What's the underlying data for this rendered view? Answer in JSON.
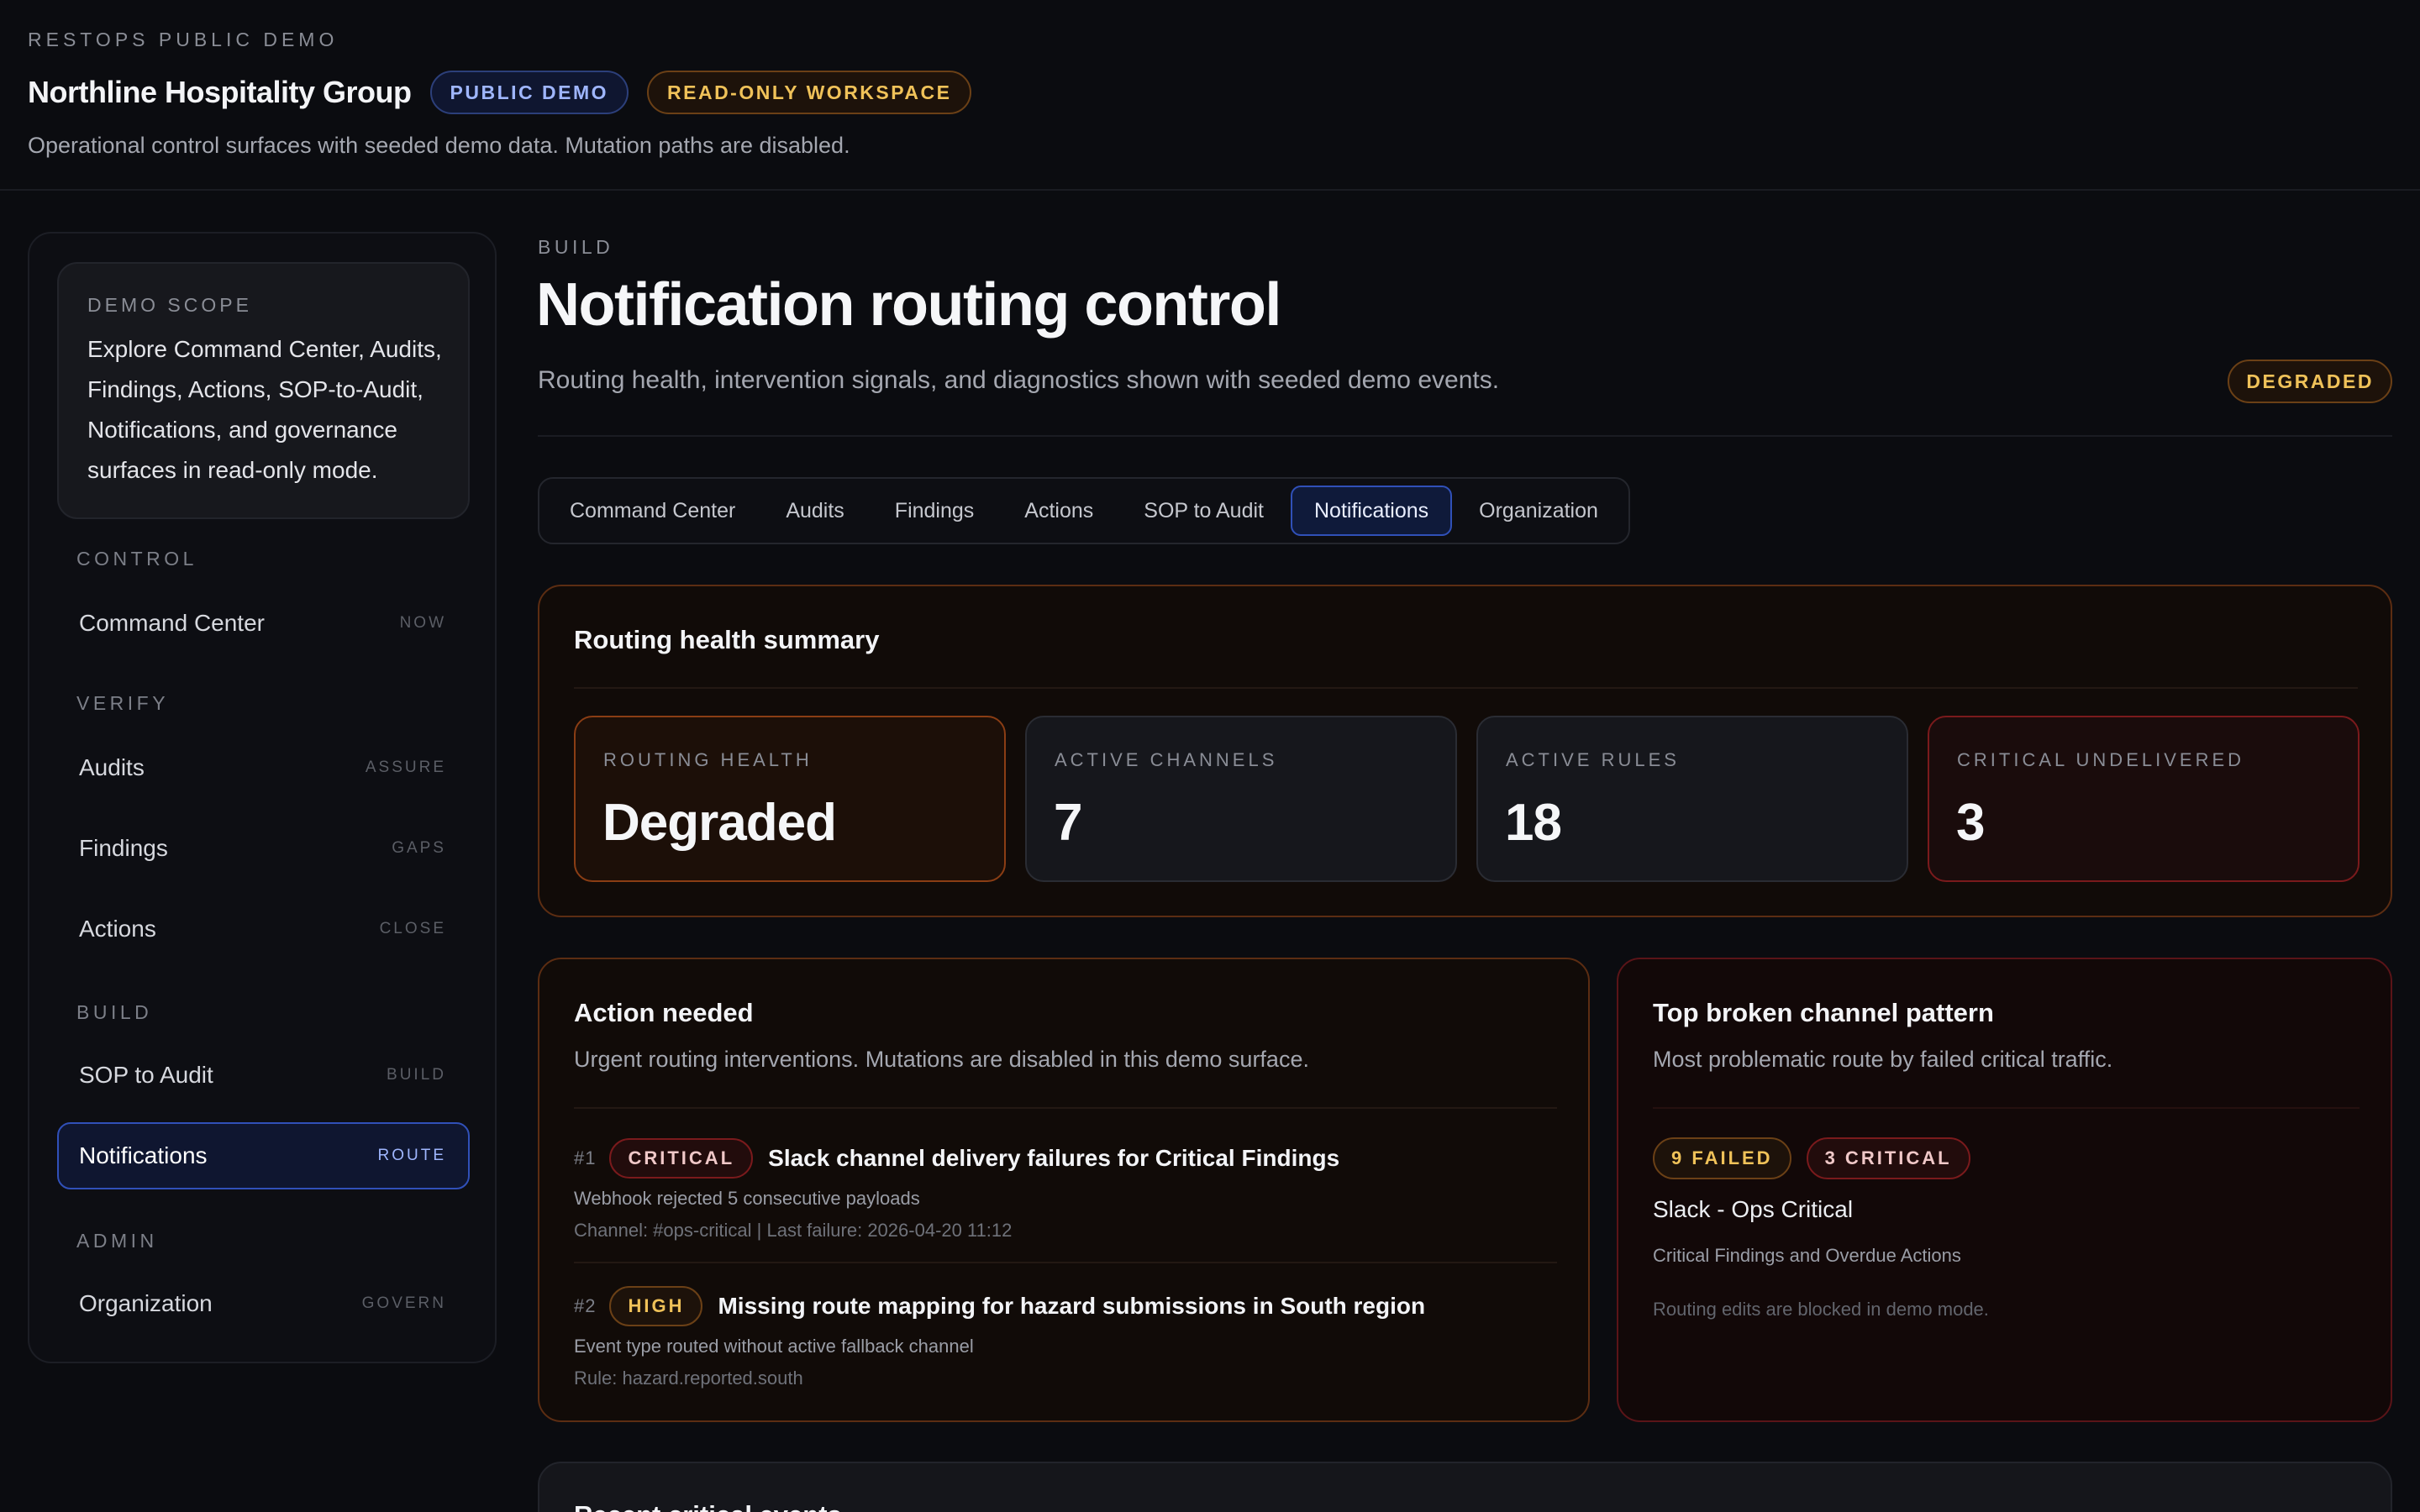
{
  "header": {
    "eyebrow": "RESTOPS PUBLIC DEMO",
    "org_name": "Northline Hospitality Group",
    "badges": [
      "PUBLIC DEMO",
      "READ-ONLY WORKSPACE"
    ],
    "subtitle": "Operational control surfaces with seeded demo data. Mutation paths are disabled."
  },
  "sidebar": {
    "scope": {
      "title": "DEMO SCOPE",
      "text": "Explore Command Center, Audits, Findings, Actions, SOP-to-Audit, Notifications, and governance surfaces in read-only mode."
    },
    "sections": [
      "CONTROL",
      "VERIFY",
      "BUILD",
      "ADMIN"
    ],
    "items": [
      {
        "label": "Command Center",
        "tag": "NOW"
      },
      {
        "label": "Audits",
        "tag": "ASSURE"
      },
      {
        "label": "Findings",
        "tag": "GAPS"
      },
      {
        "label": "Actions",
        "tag": "CLOSE"
      },
      {
        "label": "SOP to Audit",
        "tag": "BUILD"
      },
      {
        "label": "Notifications",
        "tag": "ROUTE",
        "active": true
      },
      {
        "label": "Organization",
        "tag": "GOVERN"
      }
    ]
  },
  "page": {
    "eyebrow": "BUILD",
    "title": "Notification routing control",
    "subtitle": "Routing health, intervention signals, and diagnostics shown with seeded demo events.",
    "status": "DEGRADED"
  },
  "tabs": [
    "Command Center",
    "Audits",
    "Findings",
    "Actions",
    "SOP to Audit",
    "Notifications",
    "Organization"
  ],
  "active_tab": "Notifications",
  "summary": {
    "title": "Routing health summary",
    "metrics": [
      {
        "label": "ROUTING HEALTH",
        "value": "Degraded"
      },
      {
        "label": "ACTIVE CHANNELS",
        "value": "7"
      },
      {
        "label": "ACTIVE RULES",
        "value": "18"
      },
      {
        "label": "CRITICAL UNDELIVERED",
        "value": "3"
      }
    ]
  },
  "action_needed": {
    "title": "Action needed",
    "subtitle": "Urgent routing interventions. Mutations are disabled in this demo surface.",
    "issues": [
      {
        "rank": "#1",
        "severity": "CRITICAL",
        "title": "Slack channel delivery failures for Critical Findings",
        "detail": "Webhook rejected 5 consecutive payloads",
        "meta": "Channel: #ops-critical | Last failure: 2026-04-20 11:12"
      },
      {
        "rank": "#2",
        "severity": "HIGH",
        "title": "Missing route mapping for hazard submissions in South region",
        "detail": "Event type routed without active fallback channel",
        "meta": "Rule: hazard.reported.south"
      }
    ]
  },
  "broken_channel": {
    "title": "Top broken channel pattern",
    "subtitle": "Most problematic route by failed critical traffic.",
    "badges": [
      "9 FAILED",
      "3 CRITICAL"
    ],
    "channel": "Slack - Ops Critical",
    "description": "Critical Findings and Overdue Actions",
    "note": "Routing edits are blocked in demo mode."
  },
  "bottom_card": {
    "title": "Recent critical events"
  },
  "colors": {
    "background": "#0b0c10",
    "accent_blue": "#3050b8",
    "amber": "#f0c259",
    "critical_red": "#7a1a1c"
  }
}
